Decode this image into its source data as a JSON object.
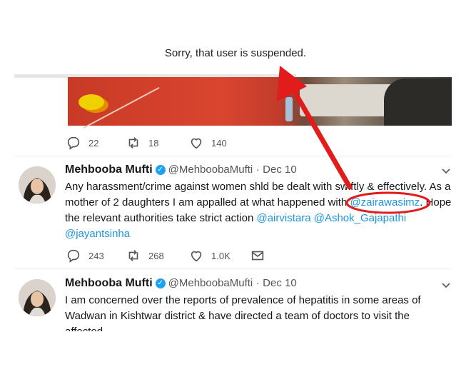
{
  "suspended_message": "Sorry, that user is suspended.",
  "tweet_top": {
    "actions": {
      "replies": "22",
      "retweets": "18",
      "likes": "140"
    }
  },
  "tweet1": {
    "name": "Mehbooba Mufti",
    "handle": "@MehboobaMufti",
    "date_sep": "·",
    "date": "Dec 10",
    "text_1": "Any harassment/crime against women shld be dealt with swiftly & effectively. As a",
    "text_2a": "mother of 2 daughters I am appalled at what happened with ",
    "mention1": "@zairawasimz",
    "text_2b": ". Hope",
    "text_3a": "the relevant authorities take strict action ",
    "mention2": "@airvistara",
    "mention3": "@Ashok_Gajapathi",
    "mention4": "@jayantsinha",
    "actions": {
      "replies": "243",
      "retweets": "268",
      "likes": "1.0K"
    }
  },
  "tweet2": {
    "name": "Mehbooba Mufti",
    "handle": "@MehboobaMufti",
    "date_sep": "·",
    "date": "Dec 10",
    "text_1": "I am concerned over the reports of prevalence of hepatitis in some areas of",
    "text_2": "Wadwan in Kishtwar district & have directed a team of doctors to visit the",
    "text_3": "affected"
  },
  "colors": {
    "link": "#1b95e0",
    "annotation": "#e21b1b",
    "verified": "#1da1f2"
  },
  "icons": [
    "reply-icon",
    "retweet-icon",
    "like-icon",
    "message-icon",
    "chevron-down-icon",
    "verified-badge-icon"
  ]
}
